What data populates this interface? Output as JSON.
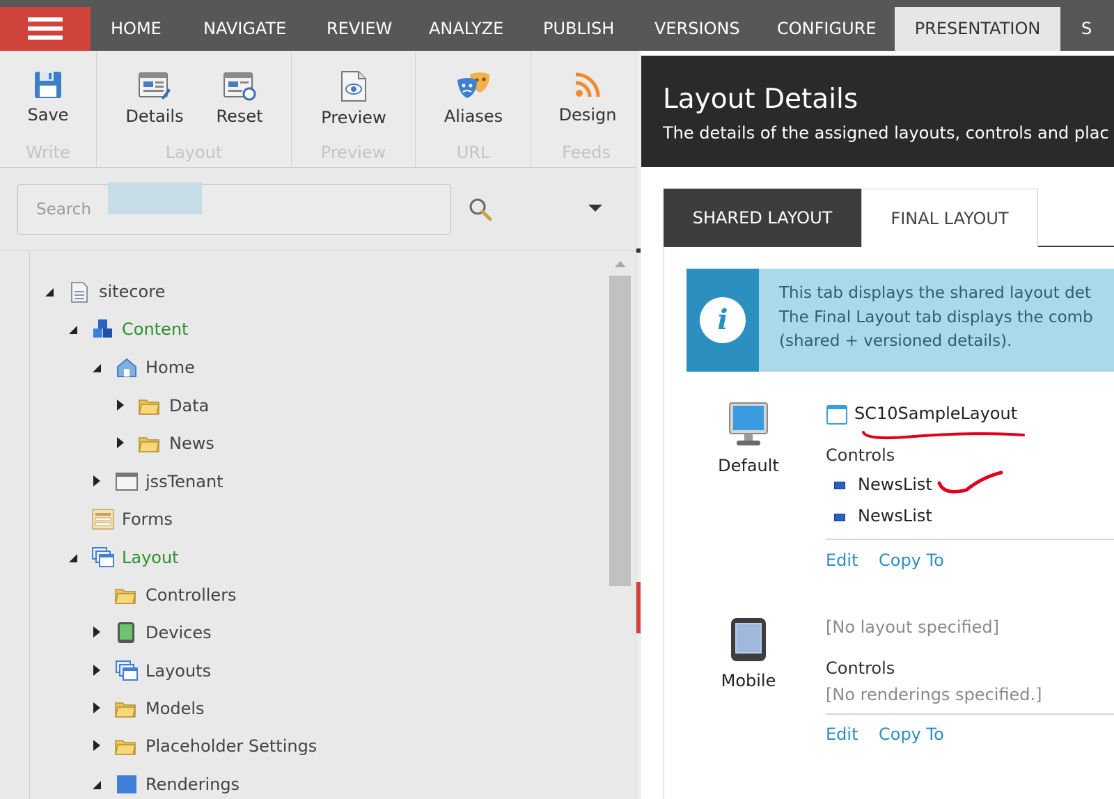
{
  "topnav": {
    "tabs": [
      "HOME",
      "NAVIGATE",
      "REVIEW",
      "ANALYZE",
      "PUBLISH",
      "VERSIONS",
      "CONFIGURE",
      "PRESENTATION",
      "S"
    ],
    "active_tab": "PRESENTATION",
    "menu_color": "#d0433a"
  },
  "ribbon": {
    "groups": [
      {
        "label": "Write",
        "buttons": [
          {
            "label": "Save",
            "icon": "save-icon"
          }
        ]
      },
      {
        "label": "Layout",
        "buttons": [
          {
            "label": "Details",
            "icon": "details-icon"
          },
          {
            "label": "Reset",
            "icon": "reset-icon"
          }
        ]
      },
      {
        "label": "Preview",
        "buttons": [
          {
            "label": "Preview",
            "icon": "preview-icon"
          }
        ]
      },
      {
        "label": "URL",
        "buttons": [
          {
            "label": "Aliases",
            "icon": "aliases-icon"
          }
        ]
      },
      {
        "label": "Feeds",
        "buttons": [
          {
            "label": "Design",
            "icon": "rss-icon"
          }
        ]
      }
    ]
  },
  "search": {
    "placeholder": "Search"
  },
  "tree": {
    "items": [
      {
        "label": "sitecore",
        "state": "expanded"
      },
      {
        "label": "Content",
        "state": "expanded"
      },
      {
        "label": "Home",
        "state": "expanded",
        "selected": true
      },
      {
        "label": "Data",
        "state": "collapsed"
      },
      {
        "label": "News",
        "state": "collapsed"
      },
      {
        "label": "jssTenant",
        "state": "collapsed"
      },
      {
        "label": "Forms",
        "state": "leaf"
      },
      {
        "label": "Layout",
        "state": "expanded"
      },
      {
        "label": "Controllers",
        "state": "leaf"
      },
      {
        "label": "Devices",
        "state": "collapsed"
      },
      {
        "label": "Layouts",
        "state": "collapsed"
      },
      {
        "label": "Models",
        "state": "collapsed"
      },
      {
        "label": "Placeholder Settings",
        "state": "collapsed"
      },
      {
        "label": "Renderings",
        "state": "expanded"
      }
    ]
  },
  "dialog": {
    "title": "Layout Details",
    "subtitle": "The details of the assigned layouts, controls and plac",
    "tabs": {
      "shared": "SHARED LAYOUT",
      "final": "FINAL LAYOUT"
    },
    "info": {
      "lines": [
        "This tab displays the shared layout det",
        "The Final Layout tab displays the comb",
        "(shared + versioned details)."
      ]
    },
    "devices": [
      {
        "name": "Default",
        "layout": "SC10SampleLayout",
        "controls_label": "Controls",
        "controls": [
          "NewsList",
          "NewsList"
        ],
        "edit": "Edit",
        "copy_to": "Copy To"
      },
      {
        "name": "Mobile",
        "layout": "[No layout specified]",
        "controls_label": "Controls",
        "no_controls": "[No renderings specified.]",
        "edit": "Edit",
        "copy_to": "Copy To"
      }
    ]
  },
  "colors": {
    "accent_blue": "#2b8fc0",
    "tree_green": "#2f8f2f",
    "annotation_red": "#e0001b"
  }
}
